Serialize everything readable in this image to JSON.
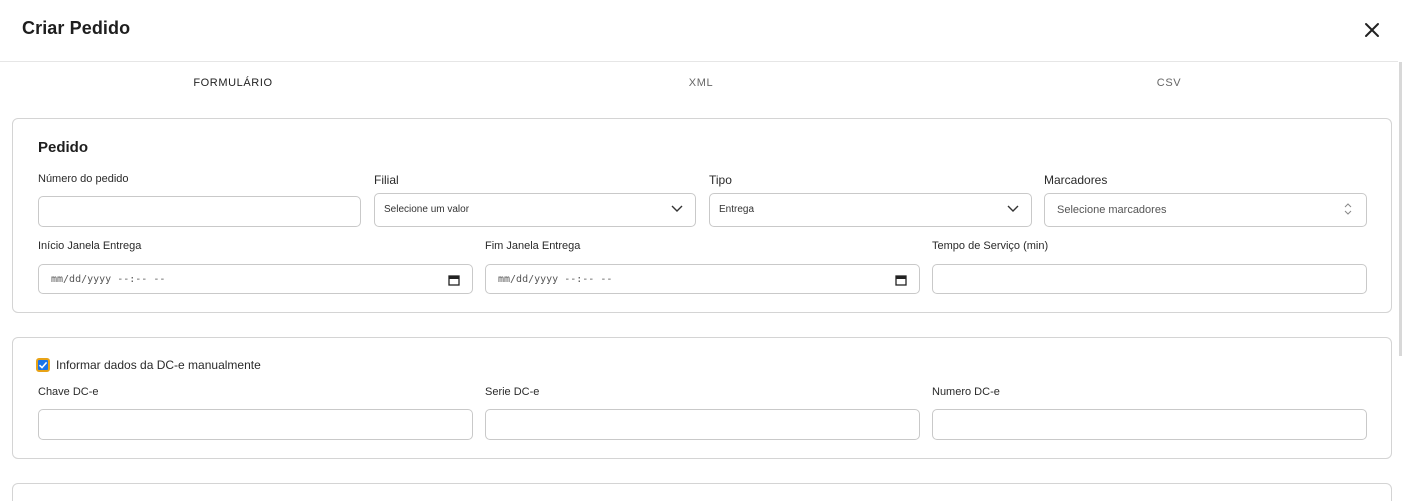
{
  "modal": {
    "title": "Criar Pedido",
    "close_icon": "close-icon"
  },
  "tabs": [
    {
      "label": "FORMULÁRIO",
      "active": true
    },
    {
      "label": "XML",
      "active": false
    },
    {
      "label": "CSV",
      "active": false
    }
  ],
  "pedido": {
    "title": "Pedido",
    "numero_label": "Número do pedido",
    "numero_value": "",
    "filial_label": "Filial",
    "filial_value": "Selecione um valor",
    "tipo_label": "Tipo",
    "tipo_value": "Entrega",
    "marcadores_label": "Marcadores",
    "marcadores_placeholder": "Selecione marcadores",
    "inicio_label": "Início Janela Entrega",
    "inicio_value": "mm/dd/yyyy --:-- --",
    "fim_label": "Fim Janela Entrega",
    "fim_value": "mm/dd/yyyy --:-- --",
    "tempo_label": "Tempo de Serviço (min)",
    "tempo_value": ""
  },
  "dce": {
    "checkbox_label": "Informar dados da DC-e manualmente",
    "checked": true,
    "chave_label": "Chave DC-e",
    "chave_value": "",
    "serie_label": "Serie DC-e",
    "serie_value": "",
    "numero_label": "Numero DC-e",
    "numero_value": ""
  },
  "colors": {
    "accent": "#1a73e8",
    "focus_ring": "#e8a317",
    "border": "#c9c9c9"
  }
}
